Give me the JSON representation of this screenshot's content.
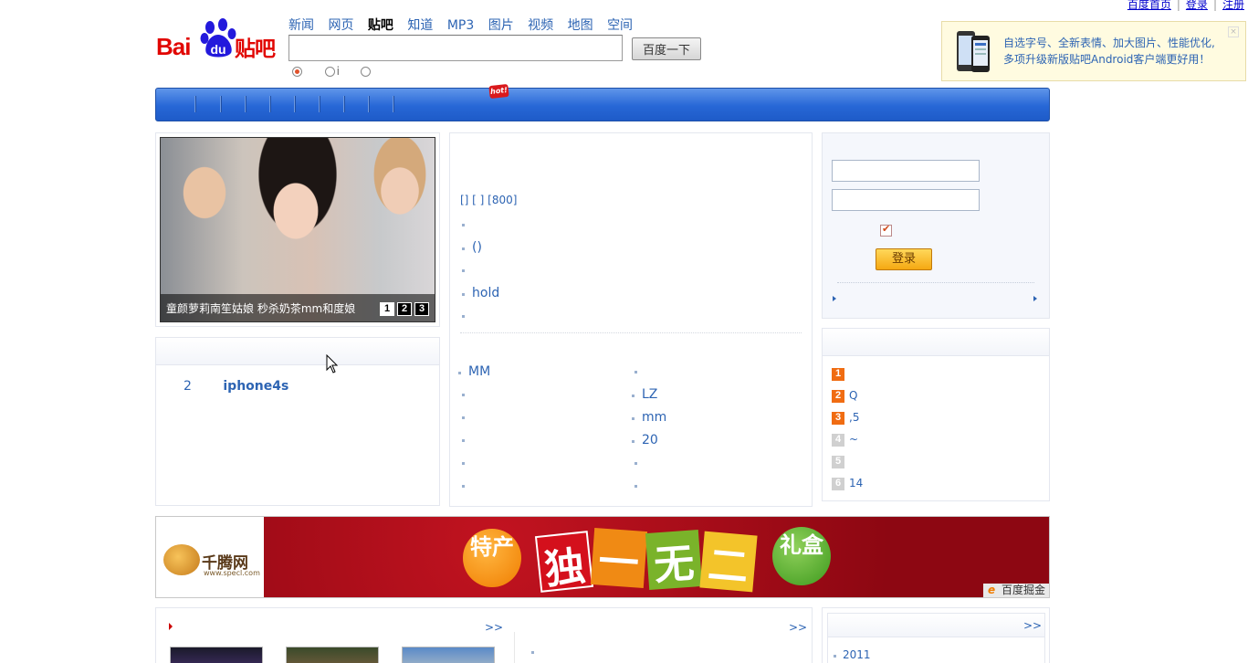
{
  "top_links": [
    "百度首页",
    "登录",
    "注册"
  ],
  "logo": {
    "bai": "Bai",
    "du": "du",
    "tieba": "贴吧"
  },
  "nav": [
    "新闻",
    "网页",
    "贴吧",
    "知道",
    "MP3",
    "图片",
    "视频",
    "地图",
    "空间"
  ],
  "nav_current": "贴吧",
  "search": {
    "value": "",
    "button_label": "百度一下",
    "radio_option_2": "i"
  },
  "promo": {
    "line1": "自选字号、全新表情、加大图片、性能优化,",
    "line2": "多项升级新版贴吧Android客户端更好用！"
  },
  "blue_bar": {
    "hot_badge": "hot!"
  },
  "slideshow": {
    "caption": "童颜萝莉南笙姑娘 秒杀奶茶mm和度娘",
    "pages": [
      "1",
      "2",
      "3"
    ],
    "active_page": "1"
  },
  "left_list": {
    "number": "2",
    "title": "iphone4s"
  },
  "center": {
    "top_link": "[] [ ] [800]",
    "items": [
      "()",
      "hold"
    ],
    "lower_left": [
      "MM",
      "",
      "",
      "",
      "",
      ""
    ],
    "lower_right": [
      "",
      "LZ",
      "mm",
      "20",
      "",
      ""
    ]
  },
  "login": {
    "username": "",
    "password": "",
    "remember_checked": true,
    "button_label": "登录"
  },
  "rank": [
    {
      "num": "1",
      "text": ""
    },
    {
      "num": "2",
      "text": "Q"
    },
    {
      "num": "3",
      "text": ",5"
    },
    {
      "num": "4",
      "text": "~"
    },
    {
      "num": "5",
      "text": ""
    },
    {
      "num": "6",
      "text": "14"
    }
  ],
  "ad": {
    "brand": "千腾网",
    "url": "www.specl.com",
    "tag_left": "特产",
    "chars": [
      "独",
      "一",
      "无",
      "二"
    ],
    "tag_right": "礼盒",
    "badge": "百度掘金"
  },
  "bottom": {
    "more_1": ">>",
    "more_2": ">>",
    "more_3": ">>",
    "year_item": "2011"
  },
  "colors": {
    "link": "#2d64b3",
    "brand_red": "#e10602",
    "bar_blue": "#2767d6",
    "rank_orange": "#f06c12"
  }
}
